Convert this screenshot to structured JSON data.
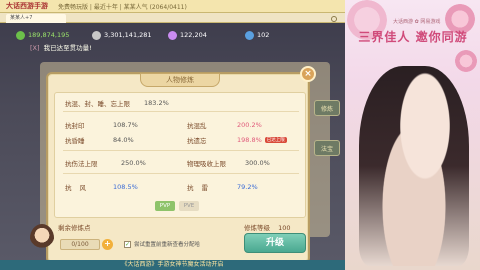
{
  "window": {
    "app_logo": "大话西游手游",
    "tab_text": "免费畅玩版 | 最近十年 | 某某人气 (2064/0411)",
    "tab_label": "某某人+7"
  },
  "hud": {
    "green_value": "189,874,195",
    "silver_value": "3,301,141,281",
    "gold_value": "122,204",
    "blue_value": "102"
  },
  "system_message": {
    "tag": "[X]",
    "text": "我已达至贯功量!"
  },
  "side_buttons": [
    "修炼",
    "法宝"
  ],
  "panel": {
    "title": "人物修炼",
    "rows": [
      {
        "label": "抗混、封、睡、忘上限",
        "value": "183.2%"
      },
      {
        "label": "抗封印",
        "value": "108.7%",
        "label2": "抗混乱",
        "value2": "200.2%"
      },
      {
        "label": "抗昏睡",
        "value": "84.0%",
        "label2": "抗遗忘",
        "value2": "198.8%",
        "badge": "已达上限"
      },
      {
        "label": "抗伤法上限",
        "value": "250.0%",
        "label2": "物理吸收上限",
        "value2": "300.0%"
      },
      {
        "label": "抗风",
        "value": "108.5%",
        "label2": "抗雷",
        "value2": "79.2%"
      }
    ],
    "tabs": {
      "pvp": "PVP",
      "pve": "PVE"
    },
    "remain_label": "剩余修炼点",
    "counter": "0/100",
    "plus": "+",
    "reset_check": "✓",
    "reset_label": "尝试重置前重新查看分配哈",
    "level_label": "修炼等级",
    "level_value": "100",
    "upgrade": "升级"
  },
  "ticker": "《大话西游》手游女神节魔女活动开启",
  "ad": {
    "brand": "大话西游 ✿ 网易游戏",
    "headline": "三界佳人 邀你同游"
  },
  "colors": {
    "accent_green": "#4aa890",
    "brand_pink": "#d04a7a",
    "panel_bg": "#f5e8c6"
  }
}
